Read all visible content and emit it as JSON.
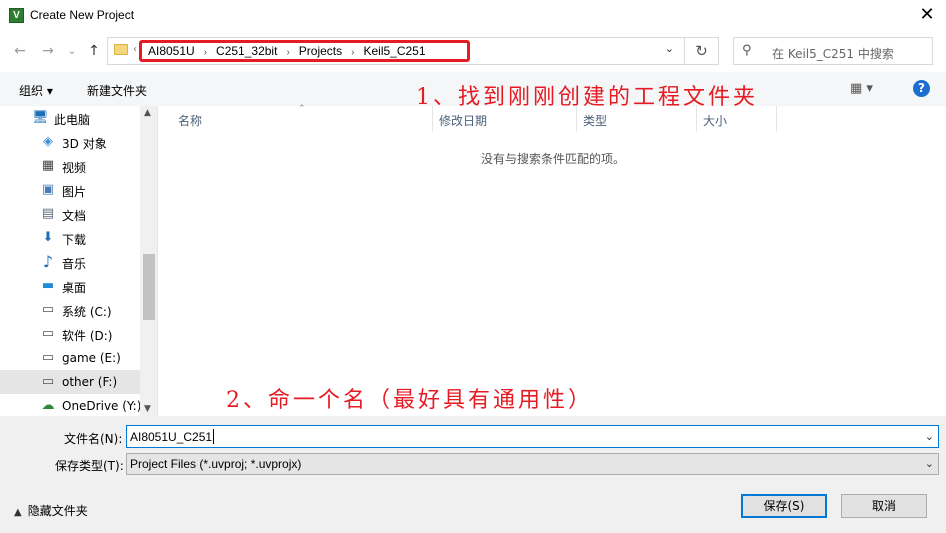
{
  "window": {
    "title": "Create New Project",
    "close": "✕"
  },
  "nav": {
    "back": "←",
    "forward": "→",
    "recent": "⌄",
    "up": "↑",
    "breadcrumb": [
      "AI8051U",
      "C251_32bit",
      "Projects",
      "Keil5_C251"
    ],
    "breadcrumb_sep": "›",
    "breadcrumb_overflow": "‹",
    "refresh": "↻",
    "search_placeholder": "在 Keil5_C251 中搜索"
  },
  "toolbar": {
    "organize": "组织 ▾",
    "new_folder": "新建文件夹",
    "view": "▦ ▾",
    "help": "?"
  },
  "annotations": {
    "step1": "1、找到刚刚创建的工程文件夹",
    "step2": "2、命一个名（最好具有通用性）",
    "color": "#e51c23"
  },
  "sidebar": {
    "items": [
      {
        "label": "此电脑",
        "icon": "🖥"
      },
      {
        "label": "3D 对象",
        "icon": "◈"
      },
      {
        "label": "视频",
        "icon": "▦"
      },
      {
        "label": "图片",
        "icon": "▣"
      },
      {
        "label": "文档",
        "icon": "▤"
      },
      {
        "label": "下载",
        "icon": "⬇"
      },
      {
        "label": "音乐",
        "icon": "♪"
      },
      {
        "label": "桌面",
        "icon": "▬"
      },
      {
        "label": "系统 (C:)",
        "icon": "▭"
      },
      {
        "label": "软件 (D:)",
        "icon": "▭"
      },
      {
        "label": "game (E:)",
        "icon": "▭"
      },
      {
        "label": "other (F:)",
        "icon": "▭"
      },
      {
        "label": "OneDrive (Y:)",
        "icon": "☁"
      }
    ],
    "selected_index": 11
  },
  "columns": {
    "name": "名称",
    "modified": "修改日期",
    "type": "类型",
    "size": "大小"
  },
  "empty_message": "没有与搜索条件匹配的项。",
  "filename": {
    "label": "文件名(N):",
    "value": "AI8051U_C251"
  },
  "filetype": {
    "label": "保存类型(T):",
    "value": "Project Files (*.uvproj; *.uvprojx)"
  },
  "hide_folders": "隐藏文件夹",
  "buttons": {
    "save": "保存(S)",
    "cancel": "取消"
  }
}
